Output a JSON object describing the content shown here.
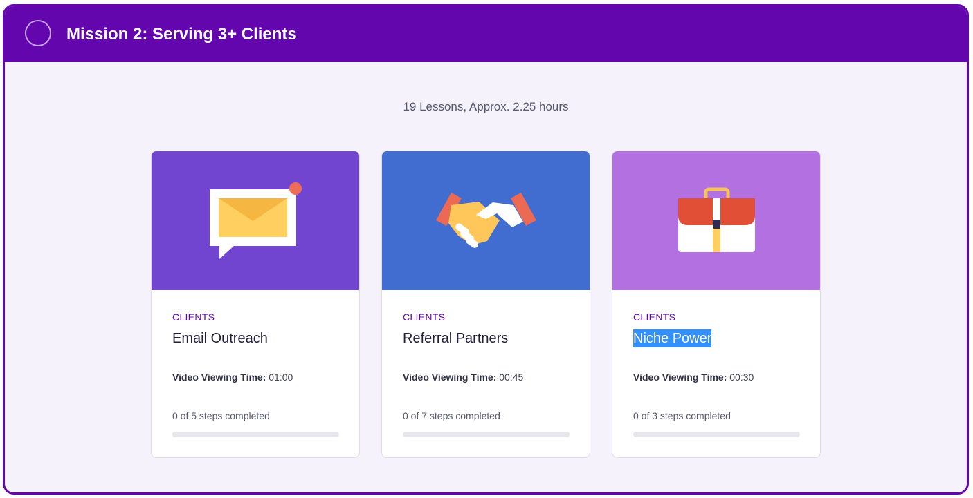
{
  "mission": {
    "title": "Mission 2: Serving 3+ Clients",
    "summary": "19 Lessons, Approx. 2.25 hours"
  },
  "cards": [
    {
      "category": "CLIENTS",
      "title": "Email Outreach",
      "meta_label": "Video Viewing Time:",
      "meta_value": " 01:00",
      "steps": "0 of 5 steps completed",
      "progress": 0,
      "image_color": "#7245d1",
      "icon": "email-chat-icon"
    },
    {
      "category": "CLIENTS",
      "title": "Referral Partners",
      "meta_label": "Video Viewing Time:",
      "meta_value": " 00:45",
      "steps": "0 of 7 steps completed",
      "progress": 0,
      "image_color": "#416dd0",
      "icon": "handshake-icon"
    },
    {
      "category": "CLIENTS",
      "title": "Niche Power",
      "meta_label": "Video Viewing Time:",
      "meta_value": " 00:30",
      "steps": "0 of 3 steps completed",
      "progress": 0,
      "image_color": "#b370e0",
      "icon": "briefcase-icon"
    }
  ],
  "colors": {
    "header": "#6406ad",
    "panel": "#f6f2fc",
    "progress_track": "#e6e6ec",
    "selection": "#3390ff"
  }
}
